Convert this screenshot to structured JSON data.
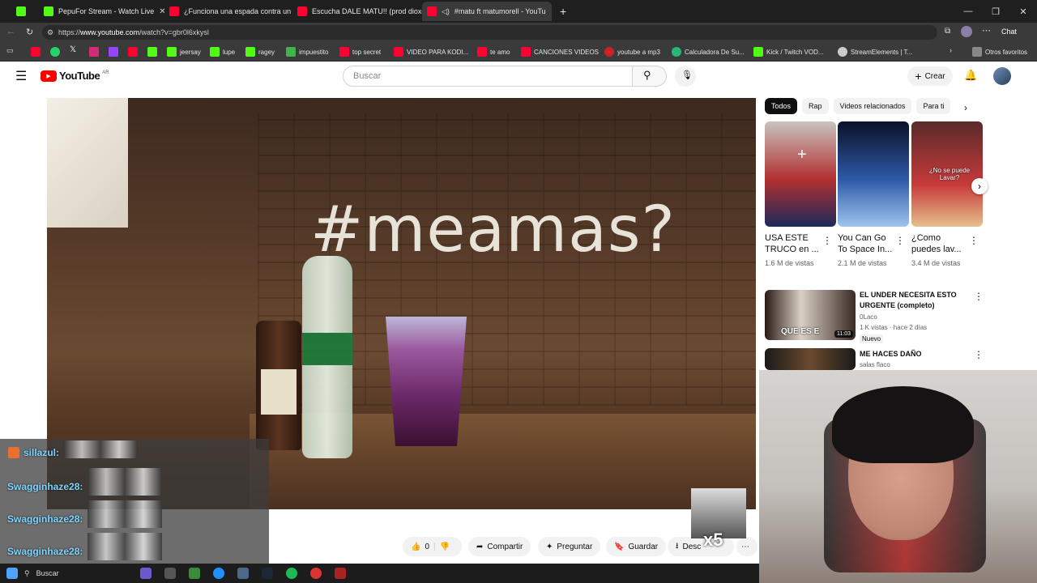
{
  "browser": {
    "tabs": [
      {
        "title": "",
        "favicon": "kick-icon"
      },
      {
        "title": "PepuFor Stream - Watch Live",
        "favicon": "kick-icon"
      },
      {
        "title": "¿Funciona una espada contra un z",
        "favicon": "youtube-icon"
      },
      {
        "title": "Escucha DALE MATU!! (prod dioxe",
        "favicon": "youtube-icon"
      },
      {
        "title": "#matu ft matumorell - YouTu",
        "favicon": "youtube-icon",
        "active": true
      }
    ],
    "url_prefix": "https://",
    "url_host": "www.youtube.com",
    "url_path": "/watch?v=gbr0l6xkysl",
    "bookmarks": [
      "jeersay",
      "lupe",
      "ragey",
      "impuestito",
      "top secret",
      "VIDEO PARA KODI...",
      "te amo",
      "CANCIONES VIDEOS",
      "youtube a mp3",
      "Calculadora De Su...",
      "Kick / Twitch VOD...",
      "StreamElements | T...",
      "Otros favoritos"
    ],
    "chat_label": "Chat"
  },
  "youtube": {
    "logo": "YouTube",
    "region": "AR",
    "search_placeholder": "Buscar",
    "create_label": "Crear",
    "video_text": "#meamas?",
    "actions": {
      "likes": "0",
      "share": "Compartir",
      "ask": "Preguntar",
      "save": "Guardar",
      "download": "Desc"
    },
    "chips": [
      "Todos",
      "Rap",
      "Videos relacionados",
      "Para ti"
    ],
    "shorts": [
      {
        "title": "USA ESTE TRUCO en ...",
        "views": "1.6 M de vistas"
      },
      {
        "title": "You Can Go To Space In...",
        "views": "2.1 M de vistas"
      },
      {
        "title": "¿Como puedes lav...",
        "views": "3.4 M de vistas",
        "overlay": "¿No se puede Lavar?"
      }
    ],
    "videos": [
      {
        "title": "EL UNDER NECESITA ESTO URGENTE (completo)",
        "channel": "0Laco",
        "meta": "1 K vistas · hace 2 días",
        "badge": "Nuevo",
        "duration": "11:03",
        "thumb_text": "QUE ES E"
      },
      {
        "title": "ME HACES DAÑO",
        "channel": "salas flaco"
      }
    ]
  },
  "stream_overlay": {
    "chat": [
      {
        "user": "sillazul:"
      },
      {
        "user": "Swagginhaze28:"
      },
      {
        "user": "Swagginhaze28:"
      },
      {
        "user": "Swagginhaze28:"
      }
    ],
    "emote_count": "x5"
  },
  "taskbar": {
    "search_label": "Buscar"
  }
}
